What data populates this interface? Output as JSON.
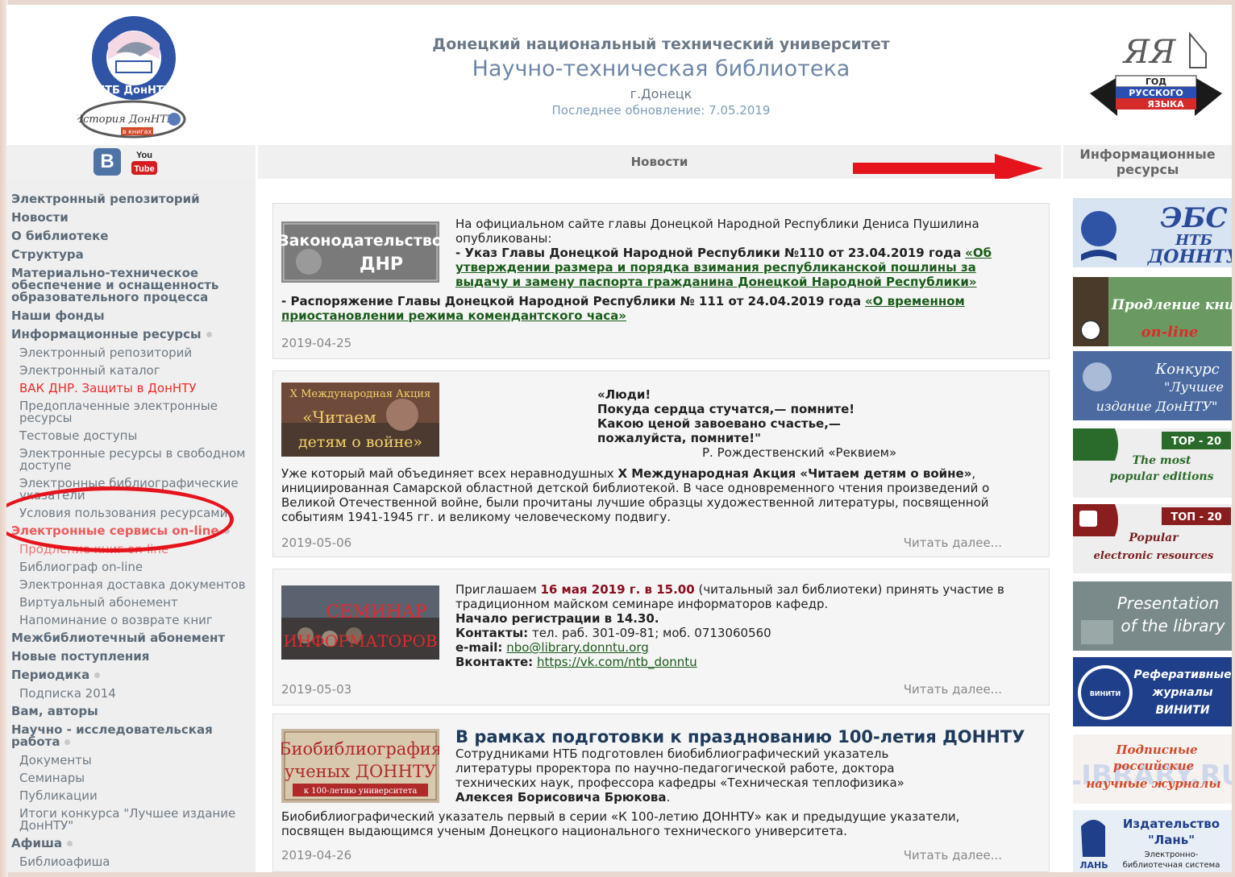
{
  "header": {
    "university": "Донецкий национальный технический университет",
    "library": "Научно-техническая библиотека",
    "city": "г.Донецк",
    "updated": "Последнее обновление: 7.05.2019",
    "logo_ntb_text": "НТБ ДонНТУ",
    "logo_history_text": "История ДонНТУ",
    "logo_history_sub": "в книгах",
    "logo_year_script": "ЯЯ",
    "logo_year_lines": [
      "ГОД",
      "РУССКОГО",
      "ЯЗЫКА"
    ]
  },
  "bars": {
    "news": "Новости",
    "info_resources": "Информационные ресурсы",
    "vk": "B",
    "youtube_top": "You",
    "youtube_bottom": "Tube"
  },
  "nav": {
    "electronic_repository": "Электронный репозиторий",
    "news": "Новости",
    "about": "О библиотеке",
    "structure": "Структура",
    "material": "Материально-техническое обеспечение и оснащенность образовательного процесса",
    "funds": "Наши фонды",
    "info_resources": "Информационные ресурсы",
    "info_sub": [
      "Электронный репозиторий",
      "Электронный каталог",
      "ВАК ДНР. Защиты в ДонНТУ",
      "Предоплаченные электронные ресурсы",
      "Тестовые доступы",
      "Электронные ресурсы в свободном доступе",
      "Электронные библиографические указатели",
      "Условия пользования ресурсами"
    ],
    "services": "Электронные сервисы on-line",
    "services_sub": [
      "Продление книг on-line",
      "Библиограф on-line",
      "Электронная доставка документов",
      "Виртуальный абонемент",
      "Напоминание о возврате книг"
    ],
    "interlibrary": "Межбиблиотечный абонемент",
    "new_arrivals": "Новые поступления",
    "periodicals": "Периодика",
    "periodicals_sub": [
      "Подписка 2014"
    ],
    "authors": "Вам, авторы",
    "research": "Научно - исследовательская работа",
    "research_sub": [
      "Документы",
      "Семинары",
      "Публикации",
      "Итоги конкурса \"Лучшее издание ДонНТУ\""
    ],
    "afisha": "Афиша",
    "afisha_sub": [
      "Библиоафиша"
    ]
  },
  "posts": [
    {
      "img_line1": "Законодательство",
      "img_line2": "ДНР",
      "intro": "На официальном сайте главы Донецкой Народной Республики Дениса Пушилина опубликованы:",
      "decree1_bold": "- Указ Главы Донецкой Народной Республики №110 от 23.04.2019 года",
      "decree1_link": "«Об утверждении размера и порядка взимания республиканской пошлины за выдачу и замену паспорта гражданина Донецкой Народной Республики»",
      "decree2_bold": "- Распоряжение Главы Донецкой Народной Республики № 111 от 24.04.2019 года",
      "decree2_link": "«О временном приостановлении режима комендантского часа»",
      "date": "2019-04-25"
    },
    {
      "img_line1": "X Международная Акция",
      "img_line2": "«Читаем",
      "img_line3": "детям о войне»",
      "poem": [
        "«Люди!",
        "Покуда сердца стучатся,— помните!",
        "Какою ценой завоевано счастье,—",
        "пожалуйста, помните!\""
      ],
      "poem_author": "Р. Рождественский «Реквием»",
      "body_start": "Уже который май объединяет всех неравнодушных",
      "body_bold": "X Международная Акция «Читаем детям о войне»",
      "body_end": ", инициированная Самарской областной детской библиотекой. В часе одновременного чтения произведений о Великой Отечественной войне, были прочитаны лучшие образцы художественной литературы, посвященной событиям 1941-1945 гг. и великому человеческому подвигу.",
      "date": "2019-05-06",
      "read_more": "Читать далее..."
    },
    {
      "img_line1": "СЕМИНАР",
      "img_line2": "ИНФОРМАТОРОВ",
      "invite_start": "Приглашаем",
      "invite_date": "16 мая 2019 г. в 15.00",
      "invite_end": "(читальный зал библиотеки) принять участие в традиционном майском семинаре информаторов кафедр.",
      "registration": "Начало регистрации в 14.30.",
      "contacts_label": "Контакты:",
      "contacts": "тел. раб. 301-09-81; моб. 0713060560",
      "email_label": "e-mail:",
      "email": "nbo@library.donntu.org",
      "vk_label": "Вконтакте:",
      "vk": "https://vk.com/ntb_donntu",
      "date": "2019-05-03",
      "read_more": "Читать далее..."
    },
    {
      "img_line1": "Биобиблиография",
      "img_line2": "ученых ДОННТУ",
      "img_line3": "к 100-летию университета",
      "title": "В рамках подготовки к празднованию 100-летия ДОННТУ",
      "text1": "Сотрудниками НТБ подготовлен биобиблиографический указатель литературы проректора по научно-педагогической работе, доктора технических наук, профессора кафедры «Техническая теплофизика»",
      "text1_bold": "Алексея Борисовича Брюкова",
      "text2": "Биобиблиографический указатель первый в серии «К 100-летию ДОННТУ» как и предыдущие указатели, посвящен выдающимся ученым Донецкого национального технического университета.",
      "date": "2019-04-26",
      "read_more": "Читать далее..."
    }
  ],
  "banners": {
    "ebs_line1": "ЭБС",
    "ebs_line2": "НТБ",
    "ebs_line3": "ДОННТУ",
    "renew_line1": "Продление кни",
    "renew_line2": "on-line",
    "contest_line1": "Конкурс",
    "contest_line2": "\"Лучшее",
    "contest_line3": "издание ДонНТУ\"",
    "top20_en_tag": "TOP - 20",
    "top20_en_line1": "The most",
    "top20_en_line2": "popular editions",
    "top20_ru_tag": "ТОП - 20",
    "top20_ru_line1": "Popular",
    "top20_ru_line2": "electronic resources",
    "presentation_line1": "Presentation",
    "presentation_line2": "of the library",
    "viniti_line1": "Реферативные",
    "viniti_line2": "журналы",
    "viniti_line3": "ВИНИТИ",
    "viniti_badge": "ВИНИТИ",
    "elib_line1": "Подписные",
    "elib_line2": "российские",
    "elib_line3": "научные журналы",
    "elib_bg": "LIBRARY.RU",
    "lan_line1": "Издательство",
    "lan_line2": "\"Лань\"",
    "lan_line3": "Электронно-",
    "lan_line4": "библиотечная система",
    "lan_logo": "ЛАНЬ"
  },
  "colors": {
    "accent_red": "#e5141c",
    "nav_text": "#5b6a78",
    "link_green": "#1a5b1a"
  }
}
